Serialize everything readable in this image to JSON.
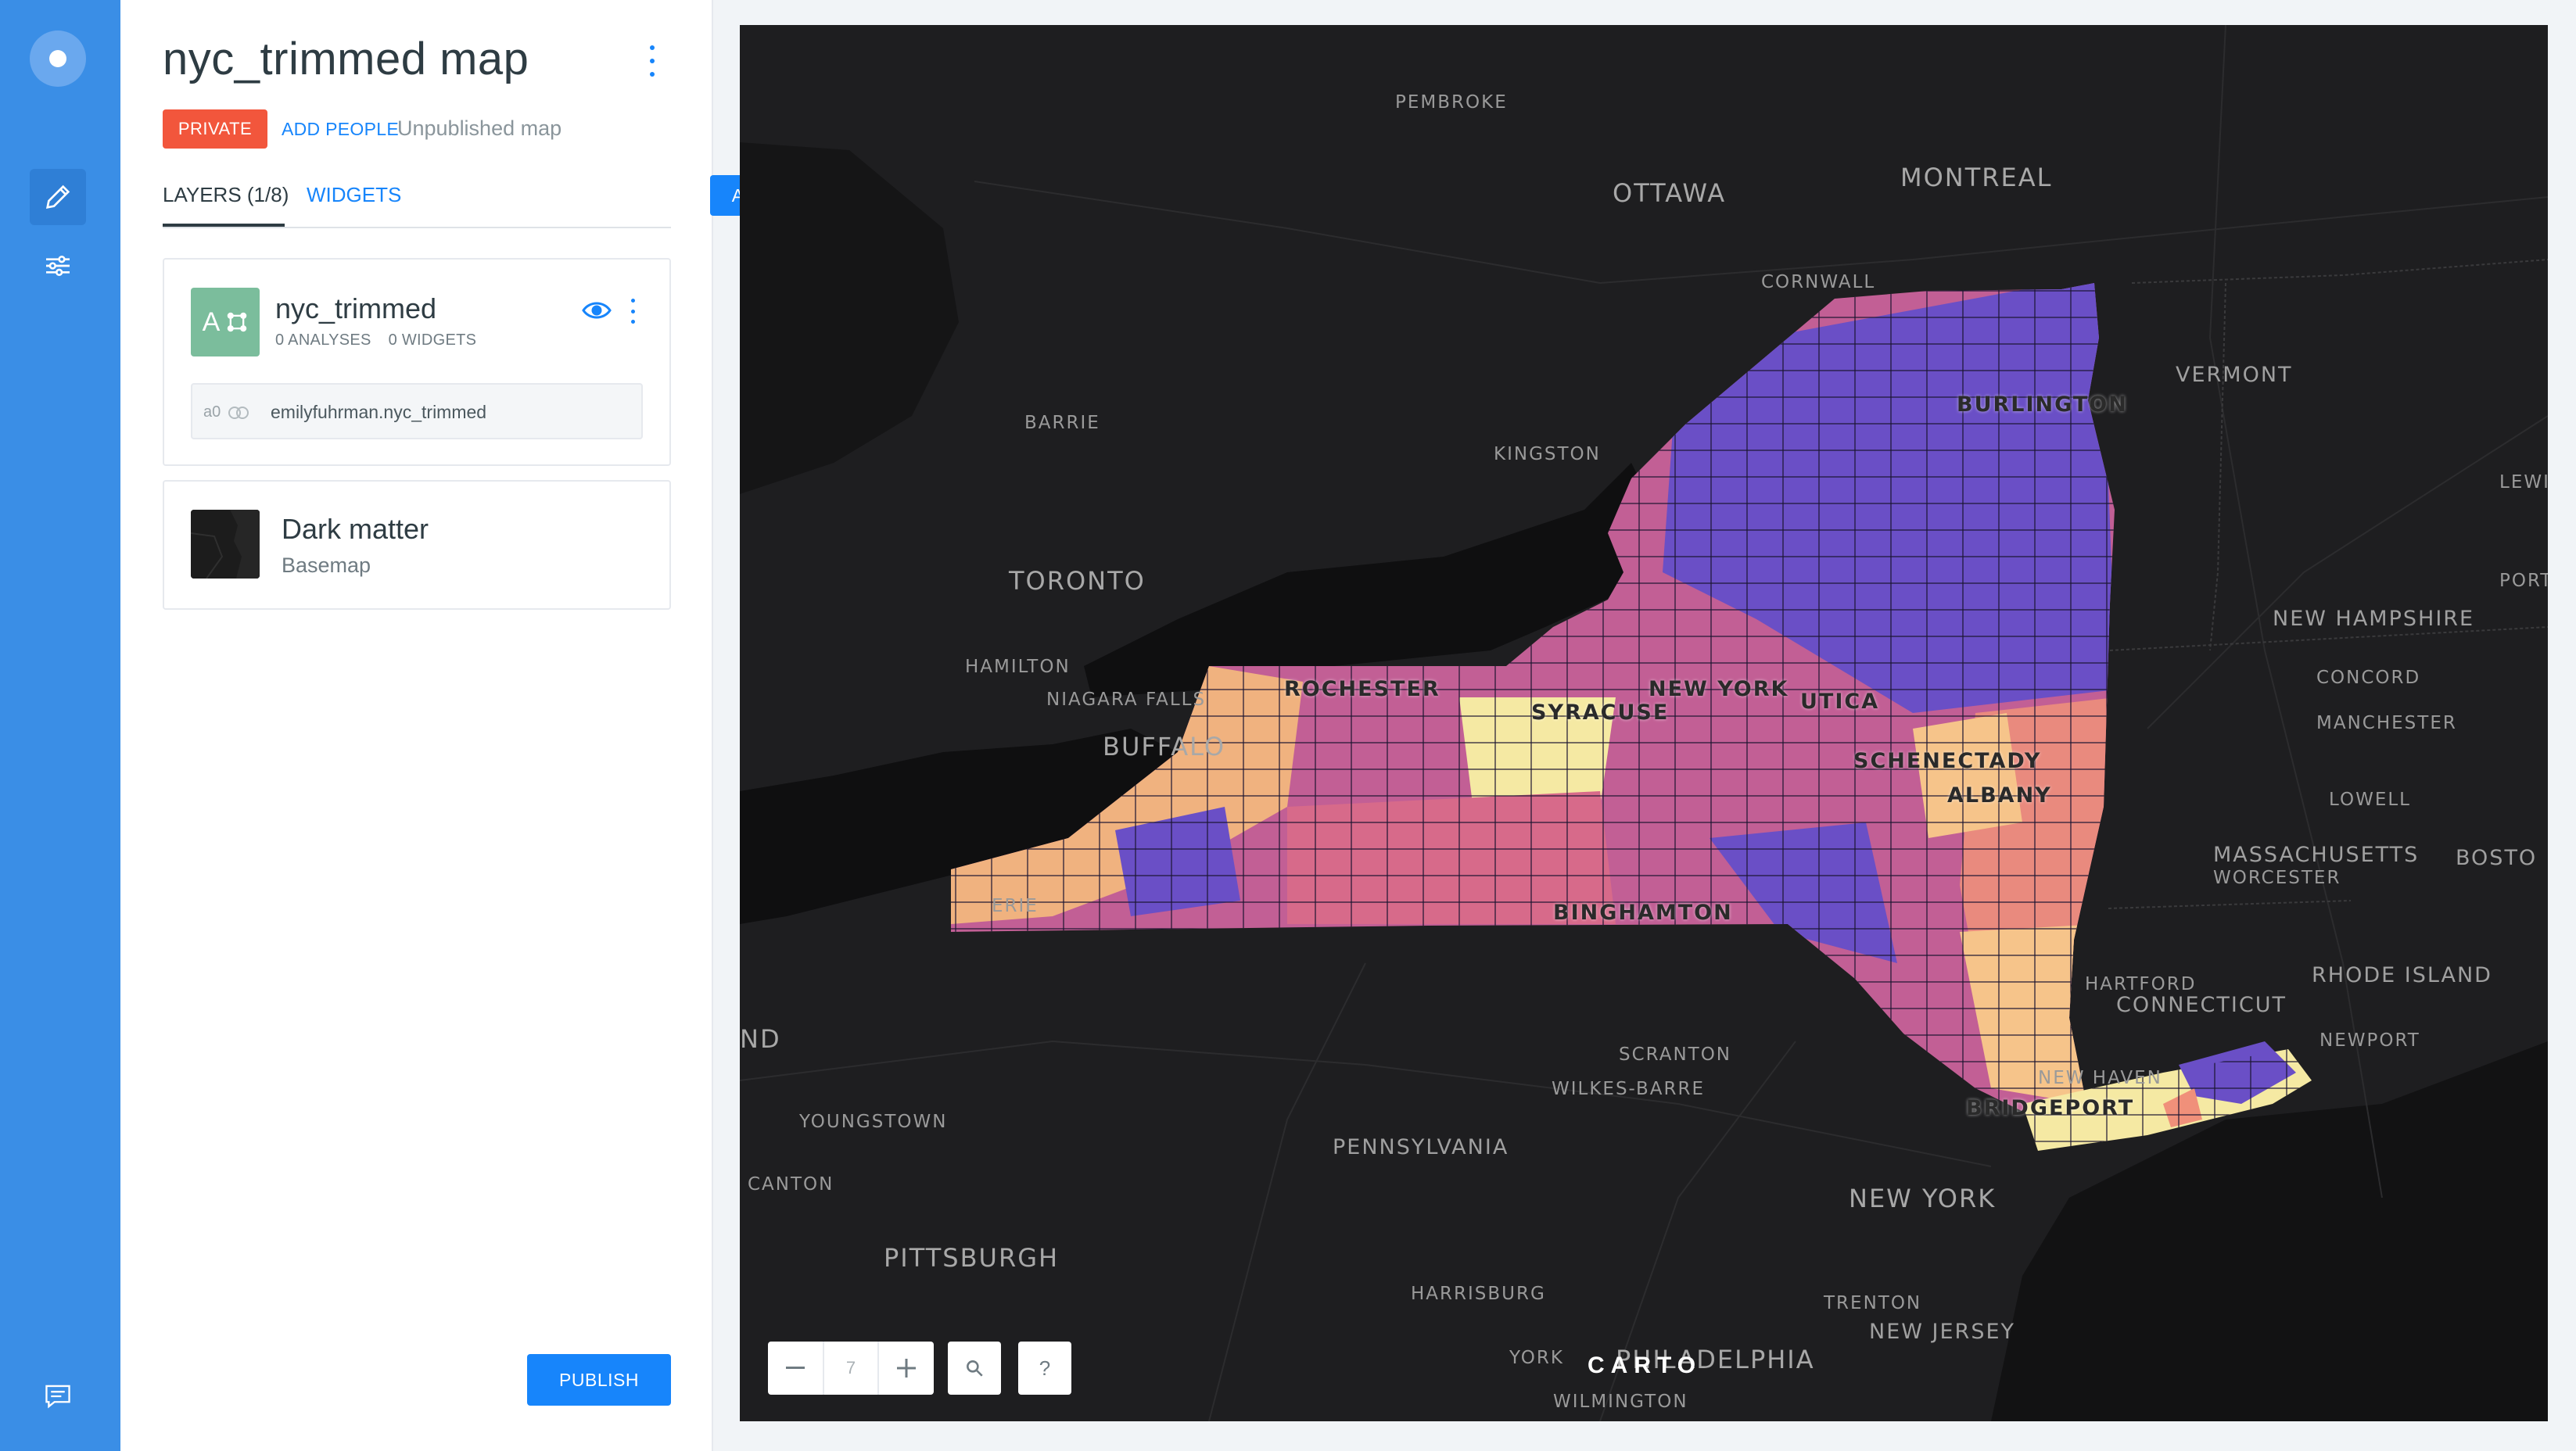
{
  "app": {
    "map_title": "nyc_trimmed map",
    "privacy_badge": "PRIVATE",
    "add_people_label": "ADD PEOPLE",
    "publish_status": "Unpublished map",
    "publish_label": "PUBLISH"
  },
  "tabs": {
    "layers_label": "LAYERS (1/8)",
    "widgets_label": "WIDGETS",
    "add_label": "ADD"
  },
  "layer": {
    "thumb_letter": "A",
    "name": "nyc_trimmed",
    "analyses": "0 ANALYSES",
    "widgets": "0 WIDGETS",
    "source_id": "a0",
    "source_name": "emilyfuhrman.nyc_trimmed",
    "thumb_color": "#7bbd9c"
  },
  "basemap": {
    "name": "Dark matter",
    "type": "Basemap"
  },
  "map": {
    "zoom": "7",
    "help_label": "?",
    "attribution_logo": "CARTO",
    "choropleth_colors": [
      "#6a4fc6",
      "#a855a0",
      "#d76a8a",
      "#f0907a",
      "#f6c48a",
      "#f5e9a3"
    ],
    "labels": {
      "pembroke": "PEMBROKE",
      "ottawa": "OTTAWA",
      "montreal": "MONTREAL",
      "cornwall": "CORNWALL",
      "burlington": "BURLINGTON",
      "vermont": "VERMONT",
      "lewiston": "LEWIST",
      "barrie": "BARRIE",
      "kingston": "KINGSTON",
      "toronto": "TORONTO",
      "portland": "PORTLA",
      "new_hampshire": "NEW HAMPSHIRE",
      "hamilton": "HAMILTON",
      "concord": "CONCORD",
      "niagara": "NIAGARA FALLS",
      "rochester": "ROCHESTER",
      "syracuse": "SYRACUSE",
      "new_york_state": "NEW YORK",
      "utica": "UTICA",
      "manchester": "MANCHESTER",
      "buffalo": "BUFFALO",
      "schenectady": "SCHENECTADY",
      "albany": "ALBANY",
      "lowell": "LOWELL",
      "massachusetts": "MASSACHUSETTS",
      "worcester": "WORCESTER",
      "boston": "BOSTO",
      "erie": "ERIE",
      "binghamton": "BINGHAMTON",
      "hartford": "HARTFORD",
      "connecticut": "CONNECTICUT",
      "rhode_island": "RHODE ISLAND",
      "cleveland_frag": "ND",
      "scranton": "SCRANTON",
      "newport": "NEWPORT",
      "wilkes_barre": "WILKES-BARRE",
      "new_haven": "NEW HAVEN",
      "youngstown": "YOUNGSTOWN",
      "bridgeport": "BRIDGEPORT",
      "pennsylvania": "PENNSYLVANIA",
      "canton": "CANTON",
      "new_york_city": "NEW YORK",
      "pittsburgh": "PITTSBURGH",
      "harrisburg": "HARRISBURG",
      "trenton": "TRENTON",
      "new_jersey": "NEW JERSEY",
      "york": "YORK",
      "philadelphia": "PHILADELPHIA",
      "wilmington": "WILMINGTON"
    }
  }
}
